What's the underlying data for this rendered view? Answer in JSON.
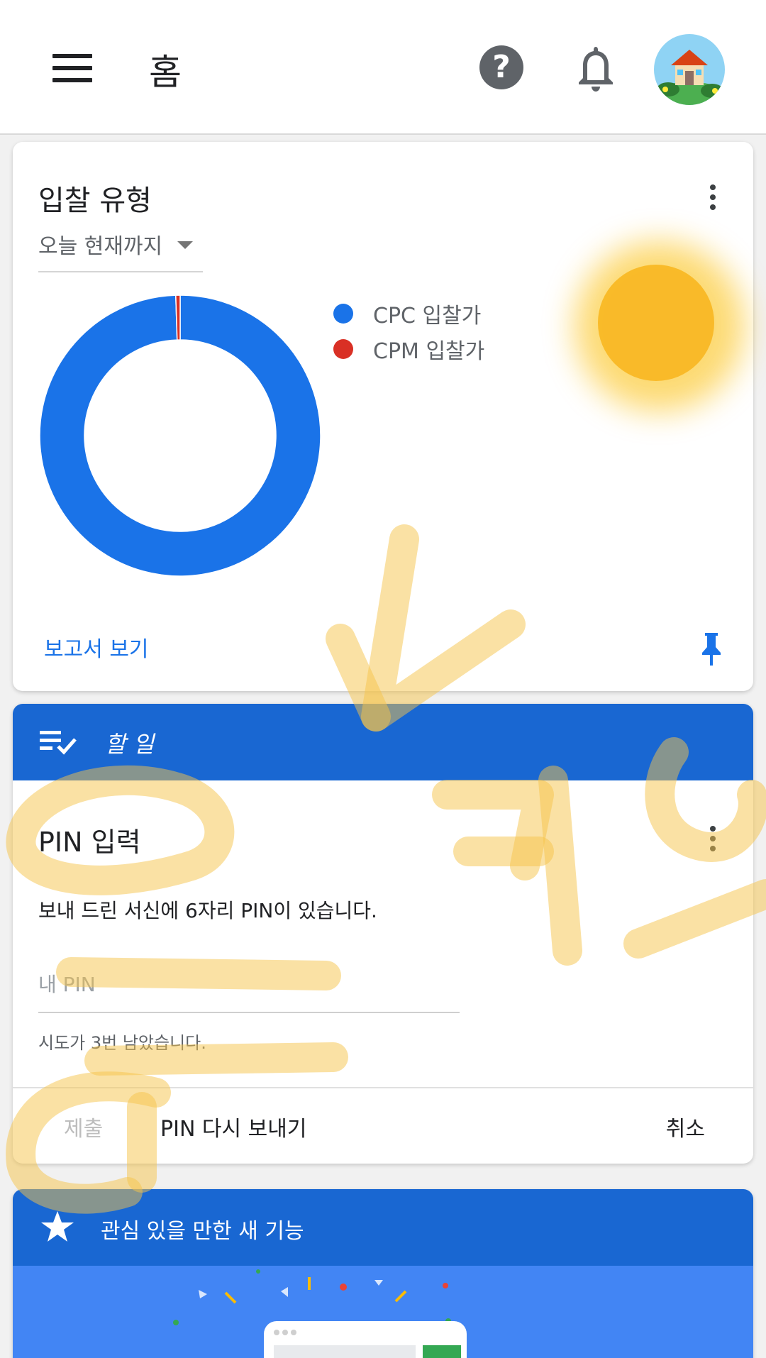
{
  "header": {
    "title": "홈",
    "menu_icon": "menu-icon",
    "help_icon": "help-icon",
    "help_glyph": "?",
    "notifications_icon": "bell-icon",
    "avatar_icon": "house-avatar"
  },
  "bid_card": {
    "title": "입찰 유형",
    "range_label": "오늘 현재까지",
    "report_link": "보고서 보기",
    "chart_data": {
      "type": "pie",
      "categories": [
        "CPC 입찰가",
        "CPM 입찰가"
      ],
      "values": [
        99.5,
        0.5
      ],
      "colors": [
        "#1a73e8",
        "#d93025"
      ],
      "legend": "right"
    }
  },
  "todo_card": {
    "header_title": "할 일",
    "pin_title": "PIN 입력",
    "description": "보내 드린 서신에 6자리 PIN이 있습니다.",
    "pin_placeholder": "내 PIN",
    "hint": "시도가 3번 남았습니다.",
    "submit_label": "제출",
    "resend_label": "PIN 다시 보내기",
    "cancel_label": "취소"
  },
  "features_card": {
    "header_title": "관심 있을 만한 새 기능"
  },
  "colors": {
    "accent_blue": "#1967d2",
    "cpc": "#1a73e8",
    "cpm": "#d93025"
  }
}
